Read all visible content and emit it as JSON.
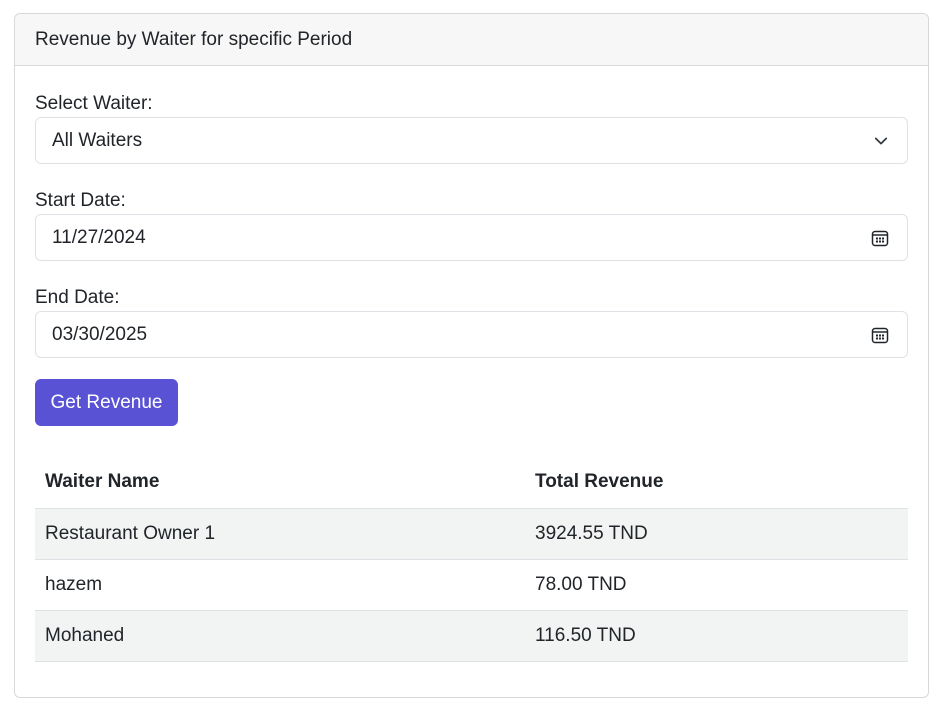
{
  "card": {
    "title": "Revenue by Waiter for specific Period"
  },
  "form": {
    "waiter_label": "Select Waiter:",
    "waiter_value": "All Waiters",
    "start_label": "Start Date:",
    "start_value": "11/27/2024",
    "end_label": "End Date:",
    "end_value": "03/30/2025",
    "submit_label": "Get Revenue"
  },
  "table": {
    "headers": [
      "Waiter Name",
      "Total Revenue"
    ],
    "rows": [
      {
        "name": "Restaurant Owner 1",
        "revenue": "3924.55 TND"
      },
      {
        "name": "hazem",
        "revenue": "78.00 TND"
      },
      {
        "name": "Mohaned",
        "revenue": "116.50 TND"
      }
    ]
  },
  "colors": {
    "accent": "#5a52d5",
    "header_bg": "#f7f7f7",
    "stripe_bg": "#f2f3f3"
  },
  "icons": {
    "select": "chevron-down-icon",
    "date": "calendar-icon"
  }
}
